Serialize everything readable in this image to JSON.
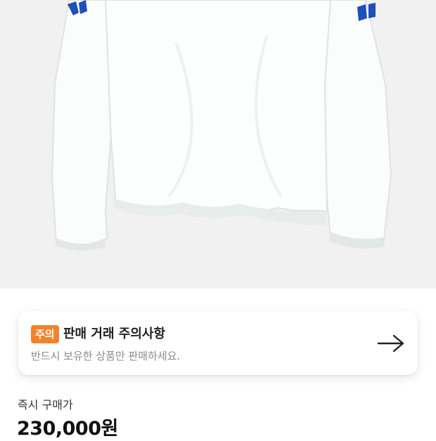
{
  "product_image": {
    "alt_icon": "shirt-photo"
  },
  "notice": {
    "badge": "주의",
    "title": "판매 거래 주의사항",
    "description": "반드시 보유한 상품만 판매하세요.",
    "arrow_icon": "arrow-right-icon",
    "badge_color": "#f5822a"
  },
  "price": {
    "label": "즉시 구매가",
    "value": "230,000원"
  }
}
